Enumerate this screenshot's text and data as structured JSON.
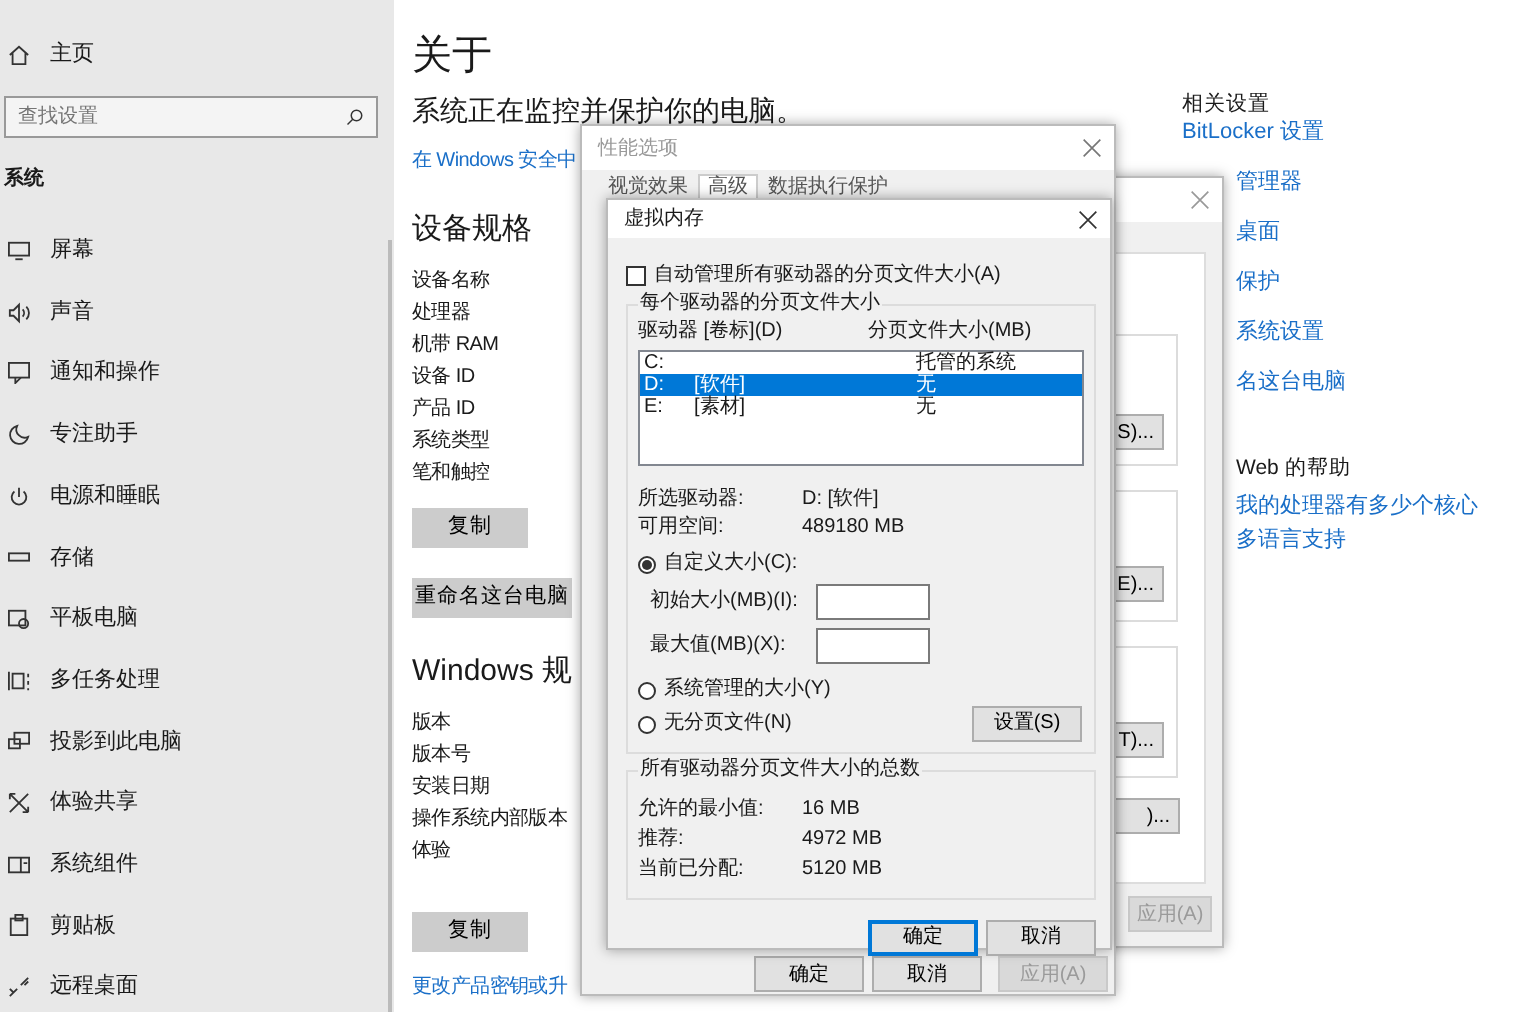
{
  "settings": {
    "sidebar": {
      "home": "主页",
      "search": {
        "placeholder": "查找设置"
      },
      "section": "系统",
      "items": [
        {
          "label": "屏幕"
        },
        {
          "label": "声音"
        },
        {
          "label": "通知和操作"
        },
        {
          "label": "专注助手"
        },
        {
          "label": "电源和睡眠"
        },
        {
          "label": "存储"
        },
        {
          "label": "平板电脑"
        },
        {
          "label": "多任务处理"
        },
        {
          "label": "投影到此电脑"
        },
        {
          "label": "体验共享"
        },
        {
          "label": "系统组件"
        },
        {
          "label": "剪贴板"
        },
        {
          "label": "远程桌面"
        }
      ]
    },
    "main": {
      "page_title": "关于",
      "status": "系统正在监控并保护你的电脑。",
      "security_link": "在 Windows 安全中",
      "device_specs": {
        "heading": "设备规格",
        "labels": [
          "设备名称",
          "处理器",
          "机带 RAM",
          "设备 ID",
          "产品 ID",
          "系统类型",
          "笔和触控"
        ],
        "buttons": [
          "复制",
          "重命名这台电脑"
        ]
      },
      "windows_specs": {
        "heading": "Windows 规",
        "labels": [
          "版本",
          "版本号",
          "安装日期",
          "操作系统内部版本",
          "体验"
        ],
        "buttons": [
          "复制"
        ],
        "link": "更改产品密钥或升"
      }
    },
    "related": {
      "heading": "相关设置",
      "links": [
        "BitLocker 设置",
        "管理器",
        "桌面",
        "保护",
        "系统设置",
        "名这台电脑"
      ],
      "help_heading": "Web 的帮助",
      "help_links": [
        "我的处理器有多少个核心",
        "多语言支持"
      ]
    }
  },
  "system_properties": {
    "buttons": [
      "S)...",
      "E)...",
      "T)...",
      ")..."
    ],
    "apply_button": {
      "label": "应用(A)",
      "disabled": true
    }
  },
  "performance_options": {
    "title": "性能选项",
    "tabs": [
      {
        "label": "视觉效果",
        "selected": false
      },
      {
        "label": "高级",
        "selected": true
      },
      {
        "label": "数据执行保护",
        "selected": false
      }
    ],
    "buttons": [
      {
        "label": "确定",
        "disabled": false
      },
      {
        "label": "取消",
        "disabled": false
      },
      {
        "label": "应用(A)",
        "disabled": true
      }
    ]
  },
  "virtual_memory": {
    "title": "虚拟内存",
    "auto_manage": {
      "label": "自动管理所有驱动器的分页文件大小(A)",
      "checked": false
    },
    "per_drive": {
      "legend": "每个驱动器的分页文件大小",
      "columns": [
        "驱动器 [卷标](D)",
        "分页文件大小(MB)"
      ],
      "drives": [
        {
          "drive": "C:",
          "size": "托管的系统",
          "selected": false
        },
        {
          "drive": "D:",
          "label": "[软件]",
          "size": "无",
          "selected": true
        },
        {
          "drive": "E:",
          "label": "[素材]",
          "size": "无",
          "selected": false
        }
      ],
      "info": [
        {
          "label": "所选驱动器:",
          "value": "D: [软件]"
        },
        {
          "label": "可用空间:",
          "value": "489180 MB"
        }
      ],
      "radios": [
        {
          "label": "自定义大小(C):",
          "selected": true
        },
        {
          "label": "系统管理的大小(Y)",
          "selected": false
        },
        {
          "label": "无分页文件(N)",
          "selected": false
        }
      ],
      "fields": [
        {
          "label": "初始大小(MB)(I):"
        },
        {
          "label": "最大值(MB)(X):"
        }
      ],
      "set_button": "设置(S)"
    },
    "totals": {
      "legend": "所有驱动器分页文件大小的总数",
      "rows": [
        {
          "label": "允许的最小值:",
          "value": "16 MB"
        },
        {
          "label": "推荐:",
          "value": "4972 MB"
        },
        {
          "label": "当前已分配:",
          "value": "5120 MB"
        }
      ]
    },
    "buttons": [
      {
        "label": "确定",
        "default": true
      },
      {
        "label": "取消",
        "default": false
      }
    ]
  }
}
